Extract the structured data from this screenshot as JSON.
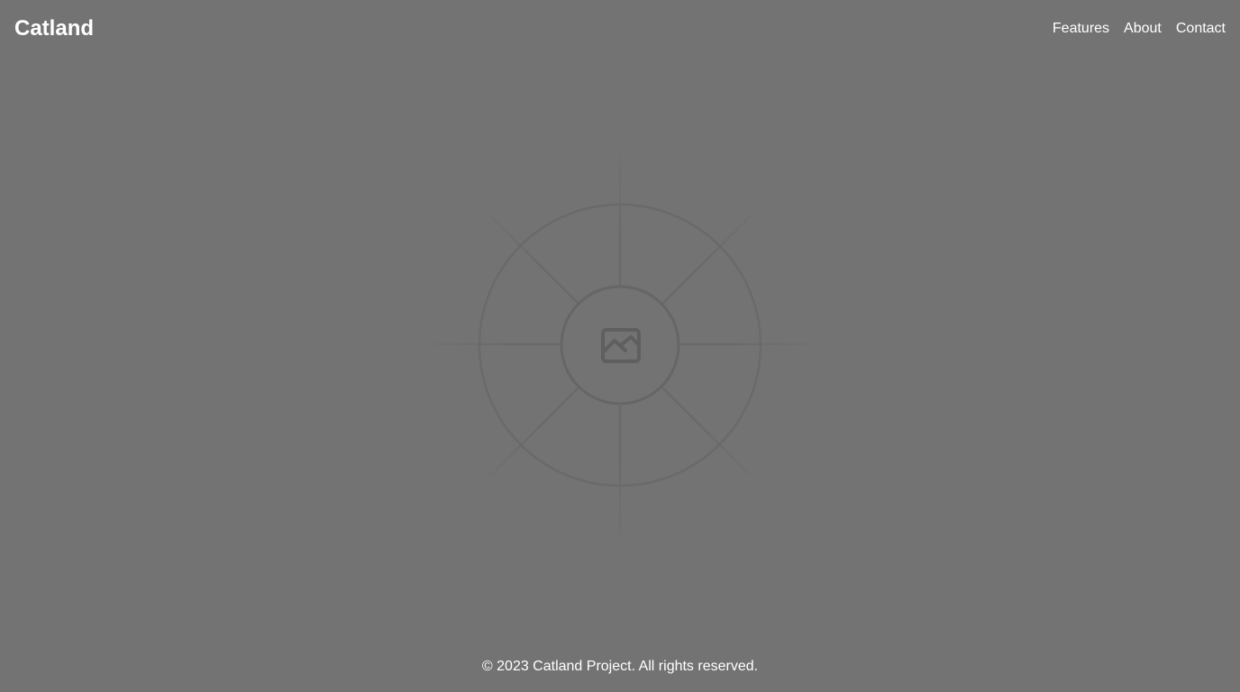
{
  "header": {
    "brand": "Catland",
    "nav": [
      {
        "label": "Features"
      },
      {
        "label": "About"
      },
      {
        "label": "Contact"
      }
    ]
  },
  "hero": {
    "placeholder_icon": "image-placeholder-icon"
  },
  "footer": {
    "copyright": "© 2023 Catland Project. All rights reserved."
  },
  "colors": {
    "background": "#737373",
    "text": "#ffffff",
    "placeholder_line": "#6a6a6a",
    "placeholder_icon": "#5f5f5f"
  }
}
